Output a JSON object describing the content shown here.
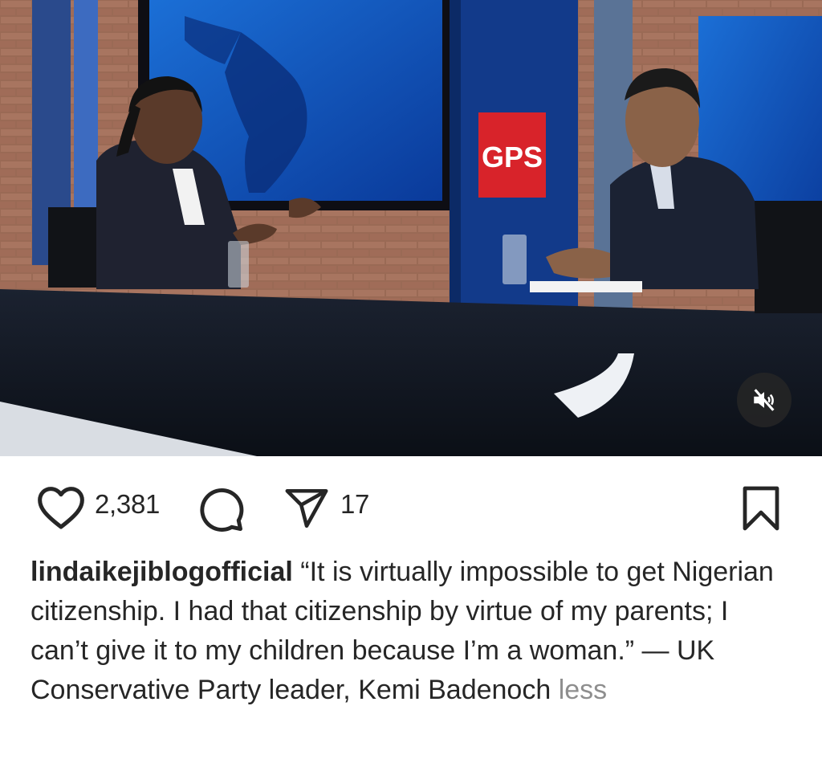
{
  "post": {
    "video": {
      "on_screen_logo": "GPS",
      "mute_icon": "speaker-muted-icon"
    },
    "actions": {
      "like_icon": "heart-icon",
      "like_count": "2,381",
      "comment_icon": "comment-bubble-icon",
      "share_icon": "paper-plane-icon",
      "share_count": "17",
      "save_icon": "bookmark-icon"
    },
    "caption": {
      "username": "lindaikejiblogofficial",
      "text": "“It is virtually impossible to get Nigerian citizenship. I had that citizenship by virtue of my parents; I can’t give it to my children because I’m a woman.” — UK Conservative Party leader, Kemi Badenoch",
      "toggle_label": "less"
    }
  }
}
